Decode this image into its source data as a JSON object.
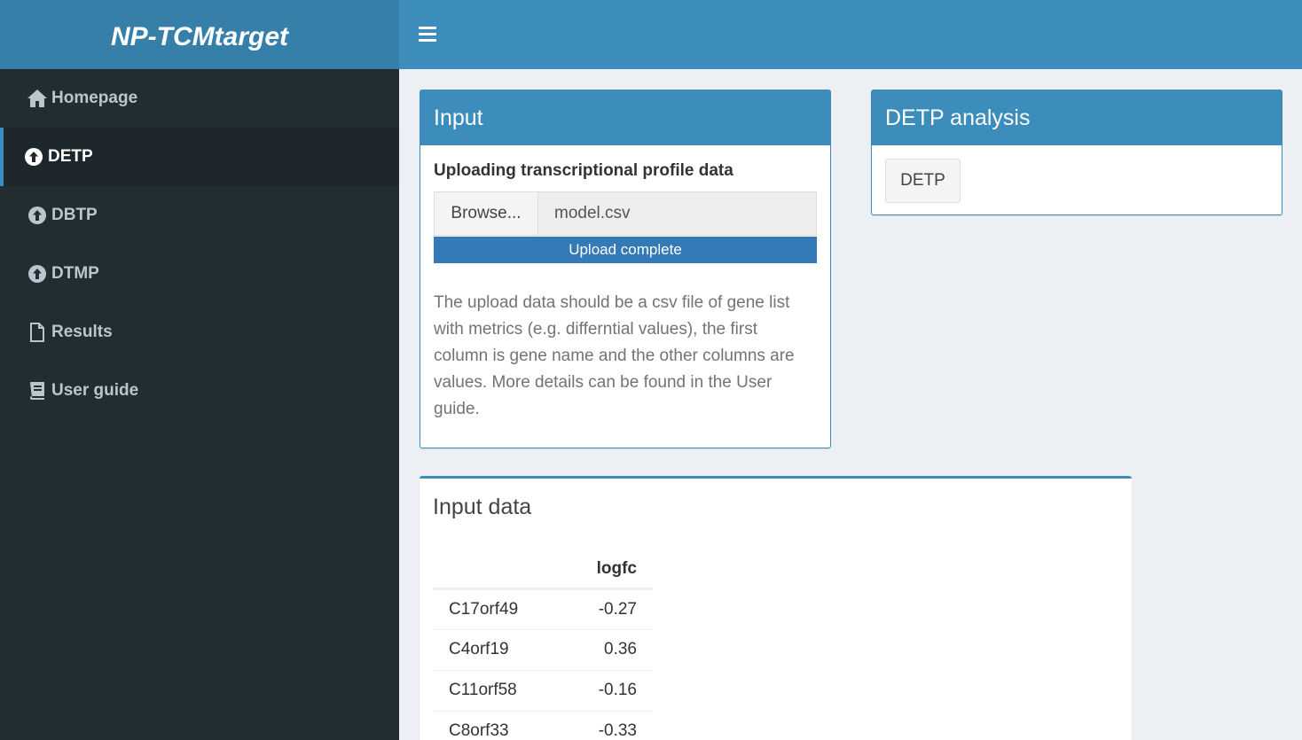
{
  "header": {
    "app_title": "NP-TCMtarget"
  },
  "sidebar": {
    "items": [
      {
        "label": "Homepage",
        "icon": "home-icon",
        "active": false
      },
      {
        "label": "DETP",
        "icon": "arrow-circle-up-icon",
        "active": true
      },
      {
        "label": "DBTP",
        "icon": "arrow-circle-up-icon",
        "active": false
      },
      {
        "label": "DTMP",
        "icon": "arrow-circle-up-icon",
        "active": false
      },
      {
        "label": "Results",
        "icon": "file-icon",
        "active": false
      },
      {
        "label": "User guide",
        "icon": "book-icon",
        "active": false
      }
    ]
  },
  "input_box": {
    "title": "Input",
    "field_label": "Uploading transcriptional profile data",
    "browse_label": "Browse...",
    "file_name": "model.csv",
    "progress_text": "Upload complete",
    "progress_fraction": 1.0,
    "help_text": "The upload data should be a csv file of gene list with metrics (e.g. differntial values), the first column is gene name and the other columns are values. More details can be found in the User guide."
  },
  "detp_box": {
    "title": "DETP analysis",
    "button_label": "DETP"
  },
  "input_data": {
    "title": "Input data",
    "columns": [
      "",
      "logfc"
    ],
    "rows": [
      {
        "gene": "C17orf49",
        "logfc": "-0.27"
      },
      {
        "gene": "C4orf19",
        "logfc": "0.36"
      },
      {
        "gene": "C11orf58",
        "logfc": "-0.16"
      },
      {
        "gene": "C8orf33",
        "logfc": "-0.33"
      }
    ]
  },
  "colors": {
    "header": "#3c8dbc",
    "brand": "#367fa9",
    "sidebar": "#222d32",
    "progress": "#337ab7",
    "background": "#ecf0f5"
  }
}
